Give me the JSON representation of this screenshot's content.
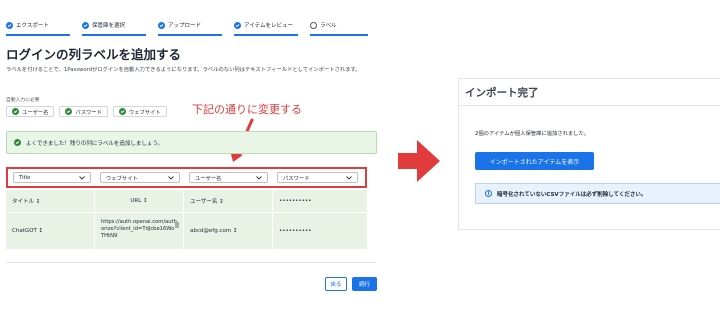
{
  "steps": [
    {
      "label": "エクスポート",
      "state": "done"
    },
    {
      "label": "保管庫を選択",
      "state": "done"
    },
    {
      "label": "アップロード",
      "state": "done"
    },
    {
      "label": "アイテムをレビュー",
      "state": "done"
    },
    {
      "label": "ラベル",
      "state": "current"
    }
  ],
  "main": {
    "title": "ログインの列ラベルを追加する",
    "description": "ラベルを付けることで、1Passwordがログインを自動入力できるようになります。ラベルのない列はテキストフィールドとしてインポートされます。",
    "autofill_label": "自動入力に必要",
    "chips": [
      "ユーザー名",
      "パスワード",
      "ウェブサイト"
    ],
    "annotation": "下記の通りに変更する",
    "success_message": "よくできました！残りの列にラベルを追加しましょう。"
  },
  "selects": [
    "Title",
    "ウェブサイト",
    "ユーザー名",
    "パスワード"
  ],
  "table": {
    "rows": [
      [
        "タイトル ↕",
        "URL ↕",
        "ユーザー名 ↕",
        "••••••••••"
      ],
      [
        "ChatGOT ↕",
        "https://auth.openai.com/authorize?client_id=TdJcbe16WoTHtN9",
        "abcd@efg.com ↕",
        "••••••••••"
      ]
    ]
  },
  "buttons": {
    "back": "戻る",
    "next": "続行"
  },
  "result": {
    "title": "インポート完了",
    "message": "2個のアイテムが個人保管庫に追加されました。",
    "view_button": "インポートされたアイテムを表示",
    "info": "暗号化されていないCSVファイルは必ず削除してください。"
  },
  "colors": {
    "accent": "#1a73e8",
    "success": "#2f8a3c",
    "annotation": "#e23b3b",
    "arrow": "#e23b3b"
  }
}
